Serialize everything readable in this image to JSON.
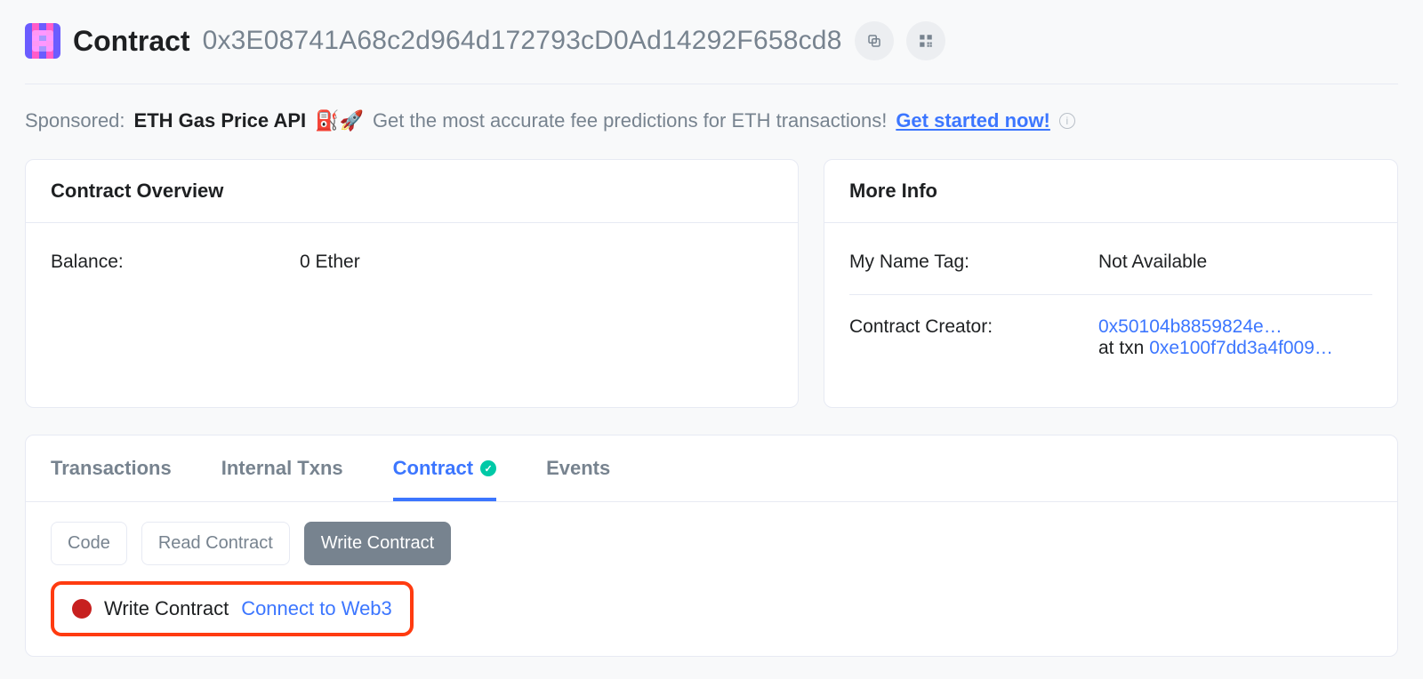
{
  "header": {
    "title": "Contract",
    "address": "0x3E08741A68c2d964d172793cD0Ad14292F658cd8"
  },
  "sponsor": {
    "label": "Sponsored:",
    "brand": "ETH Gas Price API",
    "emojis": "⛽🚀",
    "text": "Get the most accurate fee predictions for ETH transactions!",
    "cta": "Get started now!"
  },
  "overview": {
    "title": "Contract Overview",
    "balance_label": "Balance:",
    "balance_value": "0 Ether"
  },
  "more_info": {
    "title": "More Info",
    "nametag_label": "My Name Tag:",
    "nametag_value": "Not Available",
    "creator_label": "Contract Creator:",
    "creator_addr": "0x50104b8859824e…",
    "at_txn_prefix": "at txn ",
    "creator_txn": "0xe100f7dd3a4f009…"
  },
  "tabs": {
    "transactions": "Transactions",
    "internal": "Internal Txns",
    "contract": "Contract",
    "events": "Events"
  },
  "subtabs": {
    "code": "Code",
    "read": "Read Contract",
    "write": "Write Contract"
  },
  "write_area": {
    "label": "Write Contract",
    "connect": "Connect to Web3"
  }
}
